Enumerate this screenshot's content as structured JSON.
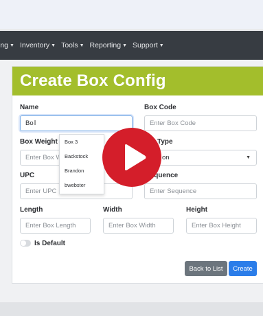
{
  "nav": {
    "items": [
      {
        "label": "ing"
      },
      {
        "label": "Inventory"
      },
      {
        "label": "Tools"
      },
      {
        "label": "Reporting"
      },
      {
        "label": "Support"
      }
    ]
  },
  "card": {
    "title": "Create Box Config"
  },
  "form": {
    "name": {
      "label": "Name",
      "value": "Bo"
    },
    "box_code": {
      "label": "Box Code",
      "placeholder": "Enter Box Code"
    },
    "box_weight": {
      "label": "Box Weight",
      "placeholder": "Enter Box W"
    },
    "box_type": {
      "label": "Type",
      "value": "on"
    },
    "upc": {
      "label": "UPC",
      "placeholder": "Enter UPC"
    },
    "sequence": {
      "label": "Sequence",
      "placeholder": "Enter Sequence"
    },
    "length": {
      "label": "Length",
      "placeholder": "Enter Box Length"
    },
    "width": {
      "label": "Width",
      "placeholder": "Enter Box Width"
    },
    "height": {
      "label": "Height",
      "placeholder": "Enter Box Height"
    },
    "is_default": {
      "label": "Is Default",
      "checked": false
    }
  },
  "autocomplete": {
    "items": [
      {
        "label": "Box 3"
      },
      {
        "label": "Backstock"
      },
      {
        "label": "Brandon"
      },
      {
        "label": "bwebster"
      }
    ]
  },
  "buttons": {
    "back": "Back to List",
    "create": "Create"
  },
  "colors": {
    "header": "#a3be2c",
    "nav": "#373c42",
    "primary": "#2b7de9",
    "secondary": "#6c757d",
    "play": "#d41e2a"
  },
  "overlay": {
    "icon": "play-icon"
  }
}
